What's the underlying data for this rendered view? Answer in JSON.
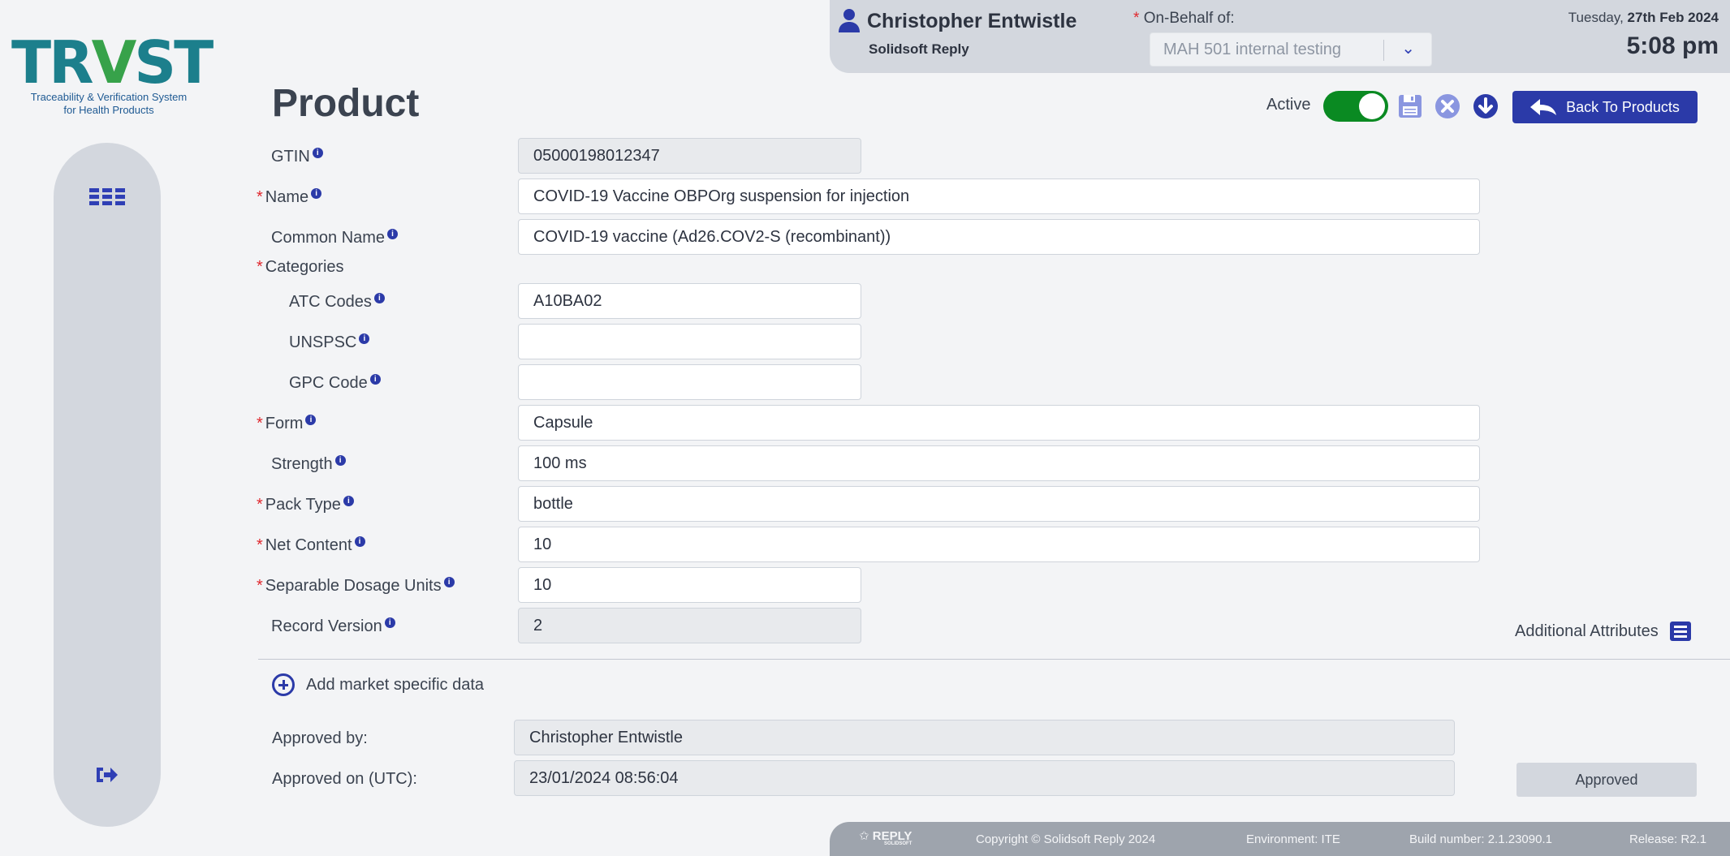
{
  "logo": {
    "mark_a": "TR",
    "mark_v": "V",
    "mark_b": "ST",
    "subtitle_line1": "Traceability & Verification System",
    "subtitle_line2": "for Health Products"
  },
  "user": {
    "name": "Christopher Entwistle",
    "org": "Solidsoft Reply",
    "on_behalf_label": "On-Behalf of:",
    "on_behalf_value": "MAH 501 internal testing"
  },
  "datetime": {
    "day": "Tuesday, ",
    "date": "27th Feb 2024",
    "time": "5:08 pm"
  },
  "page": {
    "title": "Product"
  },
  "toolbar": {
    "active_label": "Active",
    "active": true,
    "back_label": "Back To Products"
  },
  "form": {
    "gtin": {
      "label": "GTIN",
      "value": "05000198012347"
    },
    "name": {
      "label": "Name",
      "value": "COVID-19 Vaccine OBPOrg suspension for injection"
    },
    "common_name": {
      "label": "Common Name",
      "value": "COVID-19 vaccine (Ad26.COV2-S (recombinant))"
    },
    "categories": {
      "label": "Categories"
    },
    "atc": {
      "label": "ATC Codes",
      "value": "A10BA02"
    },
    "unspsc": {
      "label": "UNSPSC",
      "value": ""
    },
    "gpc": {
      "label": "GPC Code",
      "value": ""
    },
    "form": {
      "label": "Form",
      "value": "Capsule"
    },
    "strength": {
      "label": "Strength",
      "value": "100 ms"
    },
    "pack_type": {
      "label": "Pack Type",
      "value": "bottle"
    },
    "net_content": {
      "label": "Net Content",
      "value": "10"
    },
    "sep_units": {
      "label": "Separable Dosage Units",
      "value": "10"
    },
    "record_version": {
      "label": "Record Version",
      "value": "2"
    }
  },
  "additional_attributes": "Additional Attributes",
  "add_market": "Add market specific data",
  "approval": {
    "by_label": "Approved by:",
    "by_value": "Christopher Entwistle",
    "on_label": "Approved on (UTC):",
    "on_value": "23/01/2024 08:56:04",
    "status": "Approved"
  },
  "footer": {
    "brand": "REPLY",
    "brand_sub": "SOLIDSOFT",
    "copyright": "Copyright © Solidsoft Reply 2024",
    "environment": "Environment: ITE",
    "build": "Build number: 2.1.23090.1",
    "release": "Release: R2.1"
  },
  "colors": {
    "accent": "#2b3aa8",
    "toggle_on": "#0a8a22",
    "required": "#e0282e",
    "logo_teal": "#1c7f8c",
    "logo_green": "#37a24a"
  }
}
